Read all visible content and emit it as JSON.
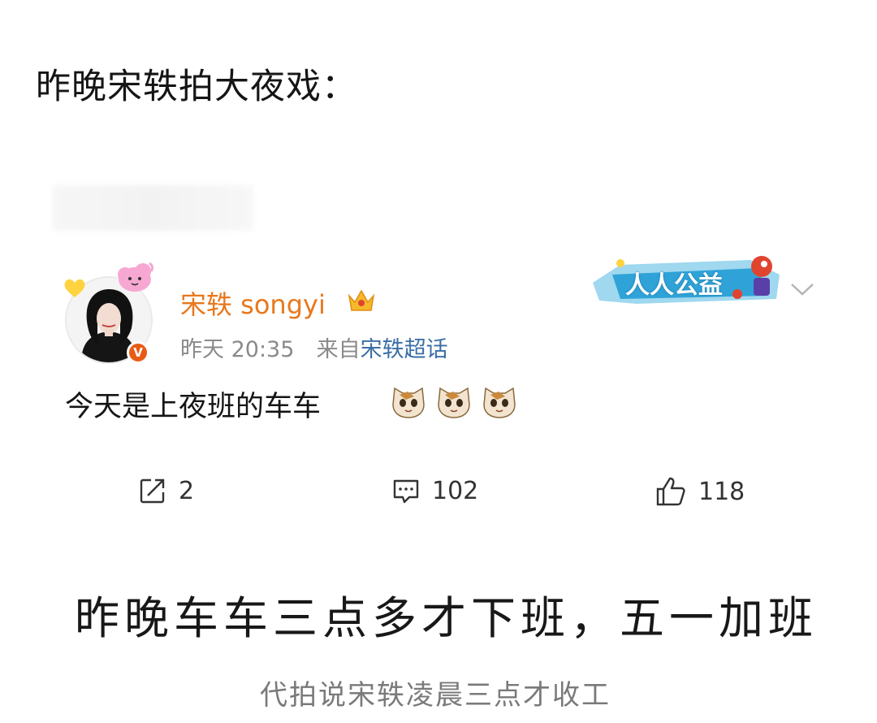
{
  "headline": "昨晚宋轶拍大夜戏：",
  "post": {
    "username": "宋轶 songyi",
    "time": "昨天 20:35",
    "source_prefix": "来自",
    "source_link": "宋轶超话",
    "text": "今天是上夜班的车车",
    "emoji_count": 3,
    "badge_text": "人人公益",
    "actions": {
      "share_count": "2",
      "comment_count": "102",
      "like_count": "118"
    }
  },
  "caption_main": "昨晚车车三点多才下班，五一加班",
  "caption_sub": "代拍说宋轶凌晨三点才收工",
  "colors": {
    "username": "#e8781d",
    "link": "#3b6ea5",
    "verified": "#e85b15",
    "badge": "#2fa3d8"
  }
}
